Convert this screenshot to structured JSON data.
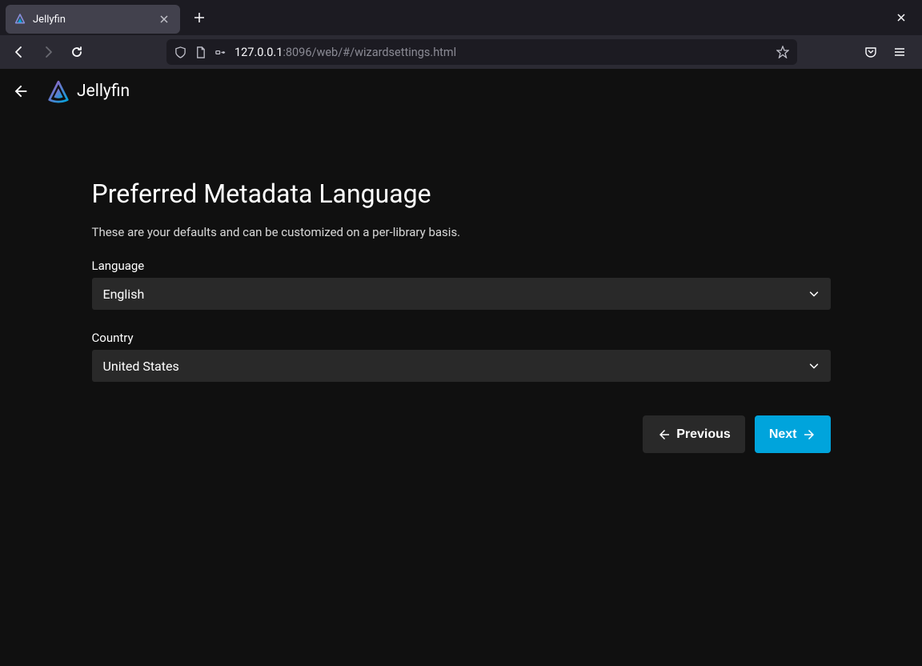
{
  "browser": {
    "tab_title": "Jellyfin",
    "url_host": "127.0.0.1",
    "url_rest": ":8096/web/#/wizardsettings.html"
  },
  "header": {
    "brand": "Jellyfin"
  },
  "page": {
    "title": "Preferred Metadata Language",
    "description": "These are your defaults and can be customized on a per-library basis."
  },
  "form": {
    "language_label": "Language",
    "language_value": "English",
    "country_label": "Country",
    "country_value": "United States"
  },
  "buttons": {
    "previous": "Previous",
    "next": "Next"
  }
}
